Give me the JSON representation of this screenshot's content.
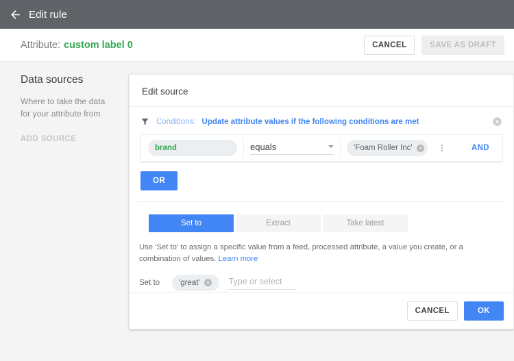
{
  "appbar": {
    "back_icon": "arrow-left-icon",
    "title": "Edit rule"
  },
  "attribute_bar": {
    "label": "Attribute:",
    "value": "custom label 0",
    "cancel_label": "CANCEL",
    "save_draft_label": "SAVE AS DRAFT",
    "accent_green": "#34a853"
  },
  "sidebar": {
    "heading": "Data sources",
    "description": "Where to take the data for your attribute from",
    "add_source_label": "ADD SOURCE"
  },
  "card": {
    "title": "Edit source",
    "conditions": {
      "filter_icon": "filter-icon",
      "label": "Conditions:",
      "text": "Update attribute values if the following conditions are met",
      "close_icon": "close-circle-icon",
      "accent_blue": "#4285f4",
      "row": {
        "attribute_chip": "brand",
        "operator": "equals",
        "value_chip": "'Foam Roller Inc'",
        "value_remove_icon": "close-circle-icon",
        "overflow_icon": "more-vert-icon",
        "conjunction": "AND"
      },
      "or_label": "OR"
    },
    "tabs": [
      {
        "label": "Set to",
        "active": true
      },
      {
        "label": "Extract",
        "active": false
      },
      {
        "label": "Take latest",
        "active": false
      }
    ],
    "help_text": "Use 'Set to' to assign a specific value from a feed, processed attribute, a value you create, or a combination of values.",
    "help_link": "Learn more",
    "set_to": {
      "label": "Set to",
      "chip_value": "'great'",
      "chip_remove_icon": "close-circle-icon",
      "input_placeholder": "Type or select",
      "input_value": ""
    },
    "footer": {
      "cancel_label": "CANCEL",
      "ok_label": "OK"
    }
  }
}
